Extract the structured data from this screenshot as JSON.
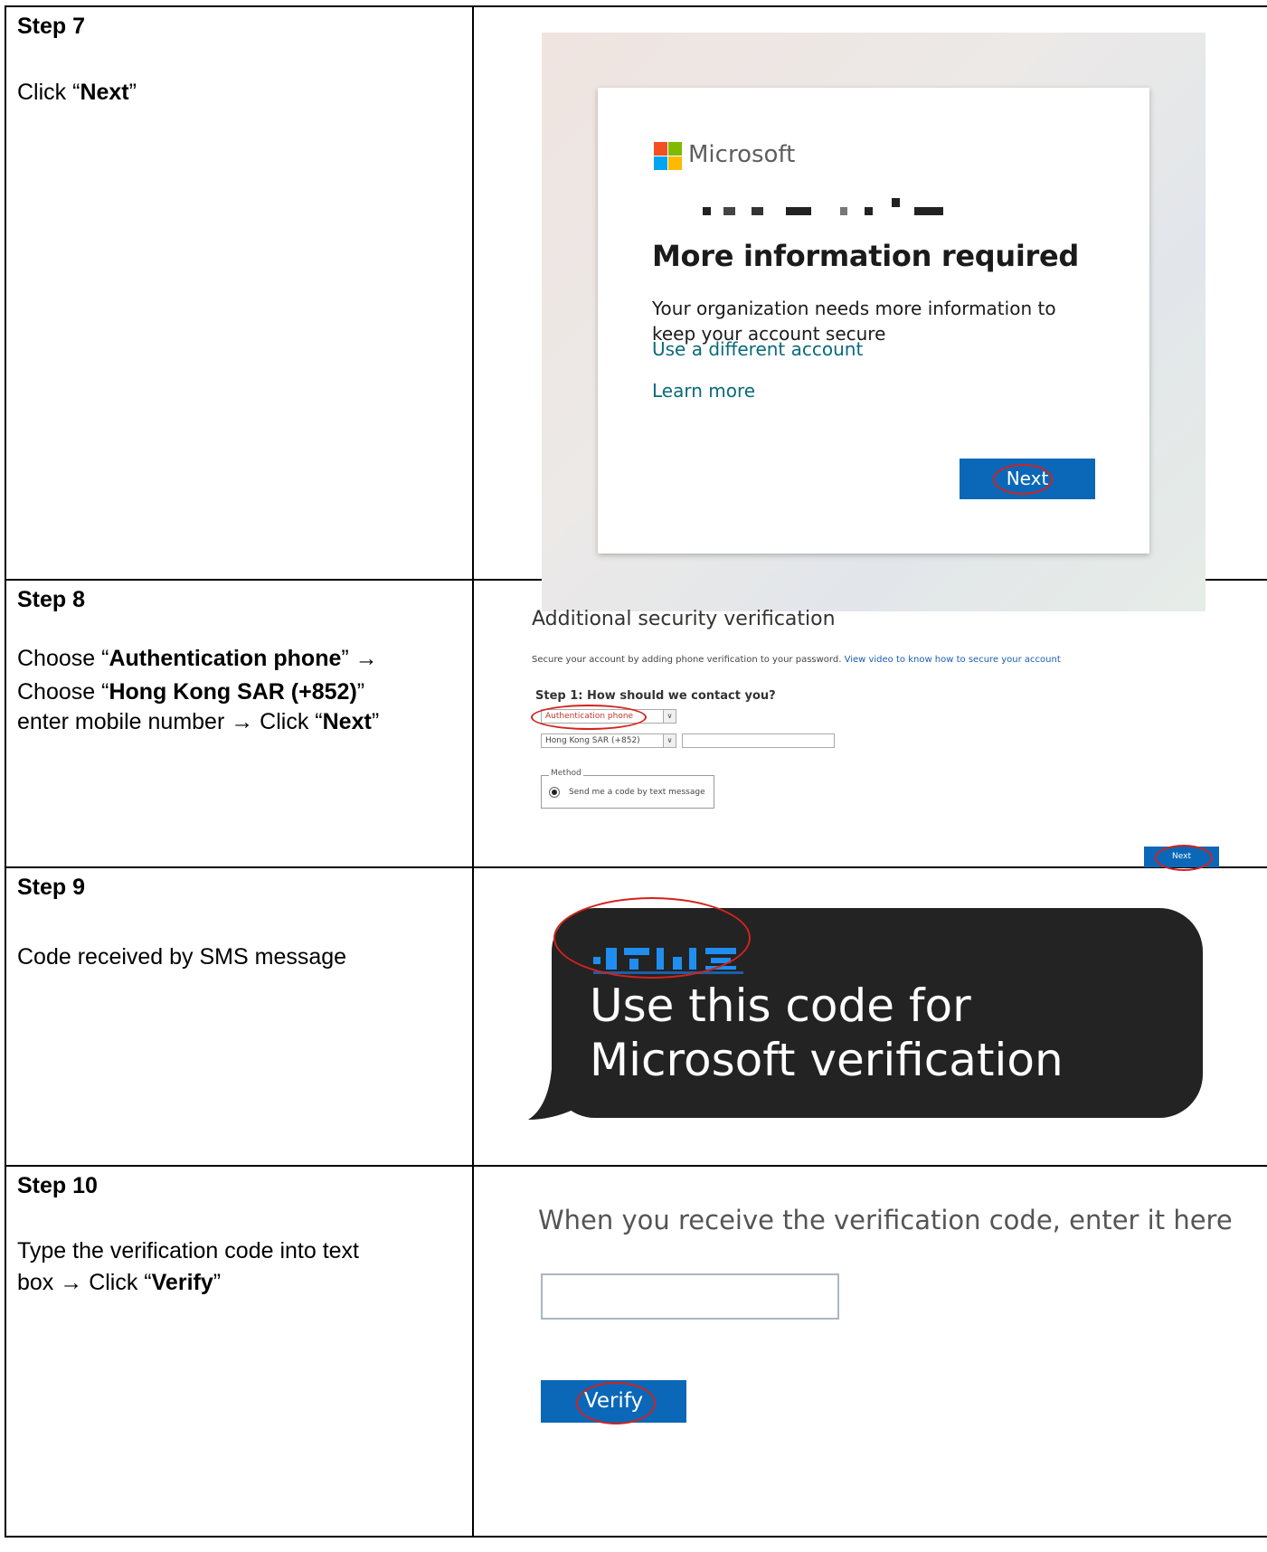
{
  "colors": {
    "accent_blue": "#0b67b8",
    "highlight_red": "#d2231d",
    "sms_bubble": "#232323",
    "link_teal": "#0a6a7a"
  },
  "steps": [
    {
      "title": "Step 7",
      "instruction": {
        "prefix": "Click “",
        "bold1": "Next",
        "suffix": "”"
      },
      "screenshot": {
        "brand": "Microsoft",
        "heading": "More information required",
        "body": "Your organization needs more information to keep your account secure",
        "link1": "Use a different account",
        "link2": "Learn more",
        "button": "Next"
      }
    },
    {
      "title": "Step 8",
      "instruction": {
        "l1_pre": "Choose “",
        "l1_bold": "Authentication phone",
        "l1_post": "” →",
        "l2_pre": "Choose “",
        "l2_bold": "Hong Kong SAR (+852)",
        "l2_post": "”",
        "l3_pre": "enter mobile number → Click “",
        "l3_bold": "Next",
        "l3_post": "”"
      },
      "screenshot": {
        "heading": "Additional security verification",
        "subtitle": "Secure your account by adding phone verification to your password.",
        "subtitle_link": "View video to know how to secure your account",
        "step_heading": "Step 1: How should we contact you?",
        "contact_select": "Authentication phone",
        "country_select": "Hong Kong SAR (+852)",
        "method_legend": "Method",
        "method_option": "Send me a code by text message",
        "button": "Next"
      }
    },
    {
      "title": "Step 9",
      "instruction": {
        "text": "Code received by SMS message"
      },
      "screenshot": {
        "message": "Use this code for Microsoft verification"
      }
    },
    {
      "title": "Step 10",
      "instruction": {
        "l1": "Type the verification code into text",
        "l2_pre": "box → Click “",
        "l2_bold": "Verify",
        "l2_post": "”"
      },
      "screenshot": {
        "prompt": "When you receive the verification code, enter it here",
        "button": "Verify"
      }
    }
  ]
}
